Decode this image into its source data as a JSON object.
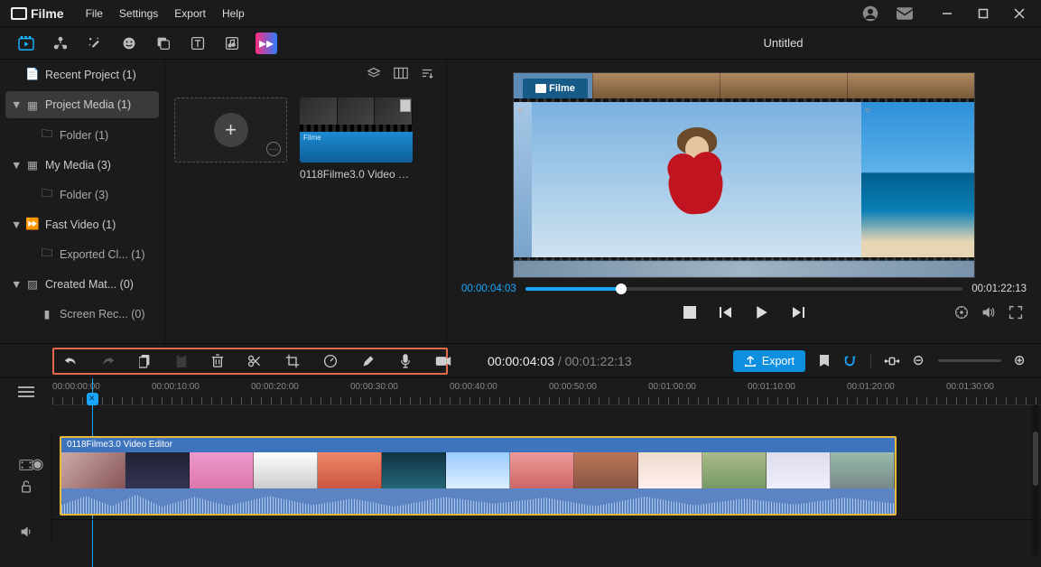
{
  "app": {
    "name": "Filme"
  },
  "menu": {
    "file": "File",
    "settings": "Settings",
    "export": "Export",
    "help": "Help"
  },
  "window": {
    "title": "Untitled"
  },
  "sidebar": {
    "recent": "Recent Project (1)",
    "project_media": "Project Media (1)",
    "project_folder": "Folder (1)",
    "my_media": "My Media (3)",
    "my_folder": "Folder (3)",
    "fast_video": "Fast Video (1)",
    "exported": "Exported Cl...  (1)",
    "created_mat": "Created Mat...  (0)",
    "screen_rec": "Screen Rec...  (0)"
  },
  "library": {
    "import_label": "",
    "clip_name": "0118Filme3.0 Video Ed..."
  },
  "preview": {
    "logo_text": "Filme",
    "current": "00:00:04:03",
    "total": "00:01:22:13"
  },
  "toolbar": {
    "export": "Export",
    "timecode_cur": "00:00:04:03",
    "timecode_dur": "00:01:22:13"
  },
  "ruler": {
    "marks": [
      "00:00:00:00",
      "00:00:10:00",
      "00:00:20:00",
      "00:00:30:00",
      "00:00:40:00",
      "00:00:50:00",
      "00:01:00:00",
      "00:01:10:00",
      "00:01:20:00",
      "00:01:30:00"
    ]
  },
  "clip": {
    "name": "0118Filme3.0 Video Editor"
  }
}
